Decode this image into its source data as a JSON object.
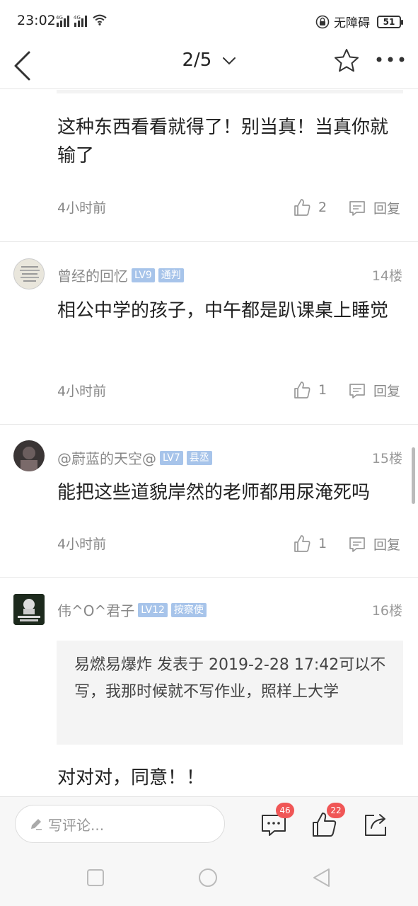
{
  "status_bar": {
    "time": "23:02",
    "net1": "4G",
    "net2": "4G",
    "accessibility": "无障碍",
    "battery": "51"
  },
  "nav": {
    "title": "2/5",
    "back_icon": "back-icon",
    "star_icon": "star-icon",
    "more_icon": "more-icon"
  },
  "comments": [
    {
      "text": "这种东西看看就得了！别当真！当真你就输了",
      "time": "4小时前",
      "likes": "2",
      "reply": "回复"
    },
    {
      "user": "曾经的回忆",
      "level": "LV9",
      "title": "通判",
      "floor": "14楼",
      "text": "相公中学的孩子，中午都是趴课桌上睡觉",
      "time": "4小时前",
      "likes": "1",
      "reply": "回复"
    },
    {
      "user": "@蔚蓝的天空@",
      "level": "LV7",
      "title": "县丞",
      "floor": "15楼",
      "text": "能把这些道貌岸然的老师都用尿淹死吗",
      "time": "4小时前",
      "likes": "1",
      "reply": "回复"
    },
    {
      "user": "伟^O^君子",
      "level": "LV12",
      "title": "按察使",
      "floor": "16楼",
      "quote": "易燃易爆炸 发表于 2019-2-28 17:42可以不写，我那时候就不写作业，照样上大学",
      "text": "对对对，同意！！"
    }
  ],
  "bottom_bar": {
    "placeholder": "写评论...",
    "comment_count": "46",
    "like_count": "22"
  },
  "colors": {
    "badge_bg": "#a7c4ea",
    "count_badge": "#f05656",
    "muted_text": "#888888"
  }
}
